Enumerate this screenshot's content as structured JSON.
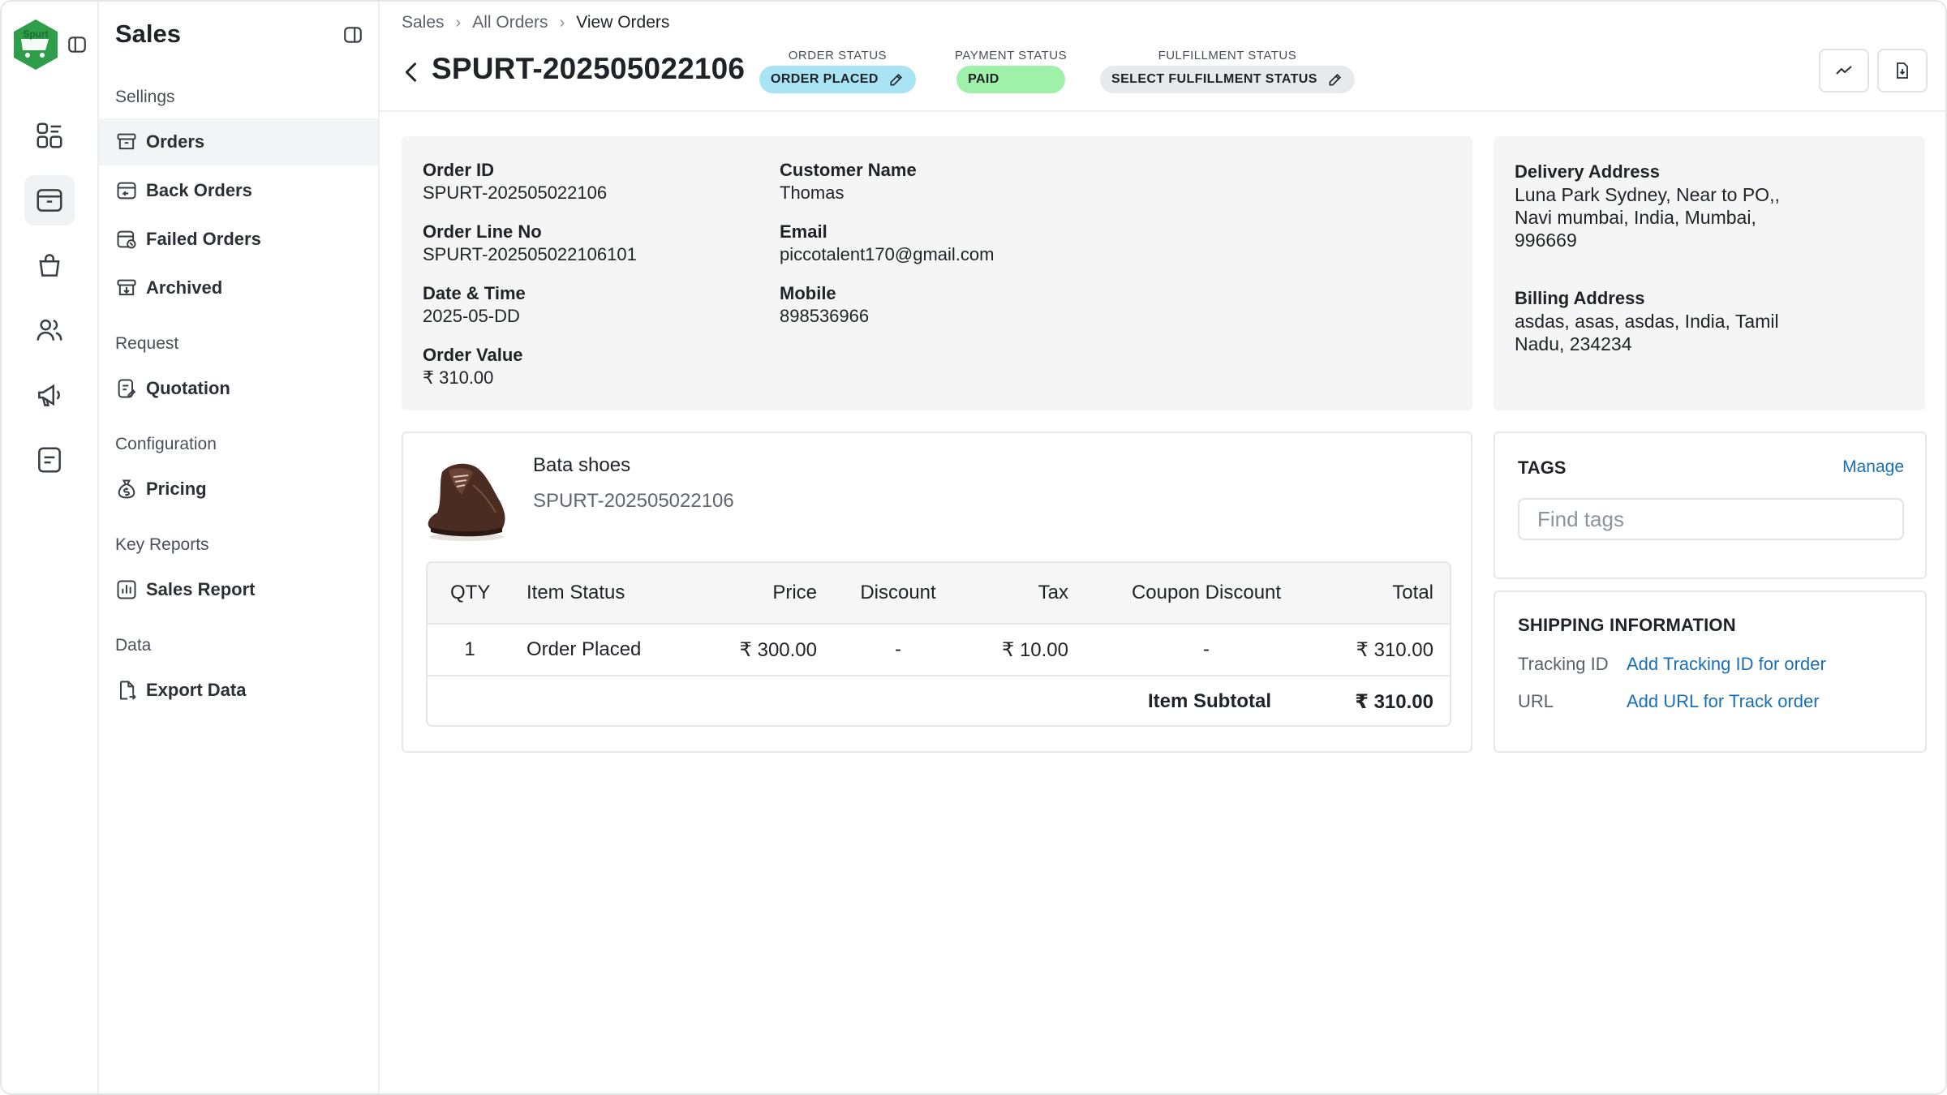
{
  "app": {
    "logo_text": "Spurt",
    "section_title": "Sales"
  },
  "rail": {
    "items": [
      "dashboard-icon",
      "orders-box-icon",
      "shopping-bag-icon",
      "users-icon",
      "megaphone-icon",
      "notes-icon"
    ]
  },
  "sidenav": {
    "sections": [
      {
        "title": "Sellings",
        "items": [
          "Orders",
          "Back Orders",
          "Failed Orders",
          "Archived"
        ]
      },
      {
        "title": "Request",
        "items": [
          "Quotation"
        ]
      },
      {
        "title": "Configuration",
        "items": [
          "Pricing"
        ]
      },
      {
        "title": "Key Reports",
        "items": [
          "Sales Report"
        ]
      },
      {
        "title": "Data",
        "items": [
          "Export Data"
        ]
      }
    ]
  },
  "breadcrumb": [
    "Sales",
    "All Orders",
    "View Orders"
  ],
  "header": {
    "order_title": "SPURT-202505022106",
    "order_status_label": "ORDER STATUS",
    "order_status_value": "ORDER PLACED",
    "payment_status_label": "PAYMENT STATUS",
    "payment_status_value": "PAID",
    "fulfillment_status_label": "FULFILLMENT STATUS",
    "fulfillment_status_value": "SELECT FULFILLMENT STATUS"
  },
  "order_details": {
    "order_id_label": "Order ID",
    "order_id": "SPURT-202505022106",
    "order_line_label": "Order Line No",
    "order_line": "SPURT-202505022106101",
    "date_label": "Date & Time",
    "date": "2025-05-DD",
    "value_label": "Order Value",
    "value": "₹ 310.00",
    "customer_label": "Customer Name",
    "customer": "Thomas",
    "email_label": "Email",
    "email": "piccotalent170@gmail.com",
    "mobile_label": "Mobile",
    "mobile": "898536966"
  },
  "addresses": {
    "delivery_label": "Delivery Address",
    "delivery_lines": [
      "Luna Park Sydney, Near to PO,,",
      "Navi mumbai, India, Mumbai,",
      "996669"
    ],
    "billing_label": "Billing Address",
    "billing_lines": [
      "asdas, asas, asdas, India, Tamil",
      "Nadu, 234234"
    ]
  },
  "product": {
    "name": "Bata shoes",
    "sku": "SPURT-202505022106",
    "image_icon": "shoe-image"
  },
  "items_table": {
    "headers": [
      "QTY",
      "Item Status",
      "Price",
      "Discount",
      "Tax",
      "Coupon Discount",
      "Total"
    ],
    "row": [
      "1",
      "Order Placed",
      "₹ 300.00",
      "-",
      "₹ 10.00",
      "-",
      "₹ 310.00"
    ],
    "subtotal_label": "Item Subtotal",
    "subtotal_value": "₹ 310.00"
  },
  "tags": {
    "title": "TAGS",
    "manage": "Manage",
    "placeholder": "Find tags"
  },
  "shipping": {
    "title": "SHIPPING INFORMATION",
    "tracking_label": "Tracking ID",
    "tracking_link": "Add Tracking ID for order",
    "url_label": "URL",
    "url_link": "Add URL for Track order"
  },
  "colors": {
    "order_status_pill": "#a9e4f5",
    "payment_status_pill": "#9ff0a8",
    "fulfillment_pill": "#e8e9ec",
    "link": "#1a6fb5",
    "logo_green": "#2e9e4a"
  }
}
